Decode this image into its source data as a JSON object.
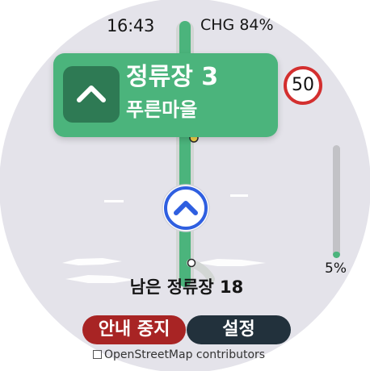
{
  "status": {
    "time": "16:43",
    "battery": "CHG 84%"
  },
  "navigation": {
    "stop_name": "정류장 3",
    "stop_area": "푸른마을",
    "turn_icon": "straight-arrow-up-icon"
  },
  "speed_limit": {
    "value": "50"
  },
  "route_progress": {
    "percent": 5,
    "label": "5%"
  },
  "remaining": {
    "text": "남은 정류장 18"
  },
  "actions": {
    "stop_label": "안내 중지",
    "settings_label": "설정"
  },
  "map": {
    "attribution": "OpenStreetMap contributors",
    "current_location_icon": "current-location-arrow-icon"
  },
  "colors": {
    "route": "#4bb47c",
    "nav_card": "#4bb47c",
    "stop_button": "#a82424",
    "settings_button": "#22313c",
    "speed_sign_border": "#d32f2f"
  }
}
